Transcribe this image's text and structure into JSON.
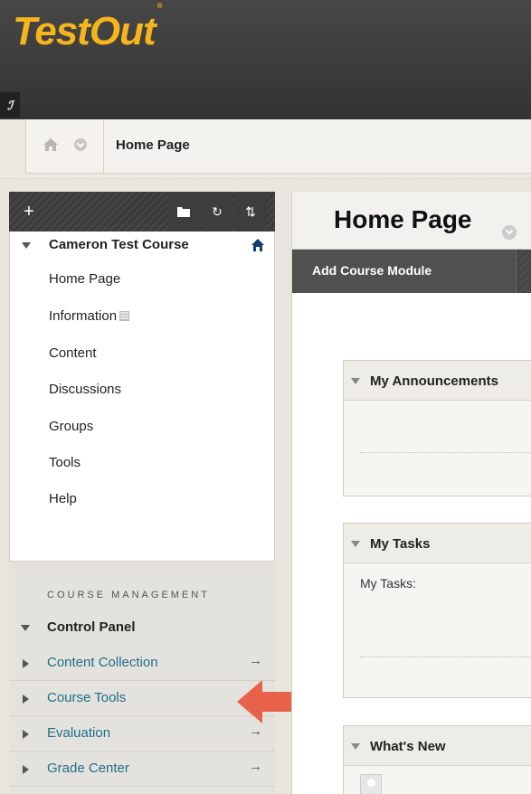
{
  "header": {
    "logo_text": "TestOut",
    "logo_mark": "®",
    "pin_icon": "link-icon"
  },
  "breadcrumb": {
    "home_icon": "home-icon",
    "current": "Home Page"
  },
  "left_toolbar": {
    "add_label": "+",
    "icons": [
      "folder-icon",
      "refresh-icon",
      "sort-icon"
    ]
  },
  "course": {
    "title": "Cameron Test Course",
    "menu": [
      "Home Page",
      "Information",
      "Content",
      "Discussions",
      "Groups",
      "Tools",
      "Help"
    ]
  },
  "course_management": {
    "heading": "COURSE MANAGEMENT",
    "control_panel": "Control Panel",
    "items": [
      {
        "label": "Content Collection",
        "arrow": "→"
      },
      {
        "label": "Course Tools",
        "arrow": ""
      },
      {
        "label": "Evaluation",
        "arrow": "→"
      },
      {
        "label": "Grade Center",
        "arrow": "→"
      }
    ]
  },
  "main": {
    "page_title": "Home Page",
    "action_button": "Add Course Module",
    "modules": [
      {
        "title": "My Announcements",
        "body": ""
      },
      {
        "title": "My Tasks",
        "body": "My Tasks:"
      },
      {
        "title": "What's New",
        "body": ""
      }
    ]
  },
  "colors": {
    "logo": "#f7b51c",
    "link": "#1f6e8c",
    "highlight_arrow": "#e8624b"
  }
}
